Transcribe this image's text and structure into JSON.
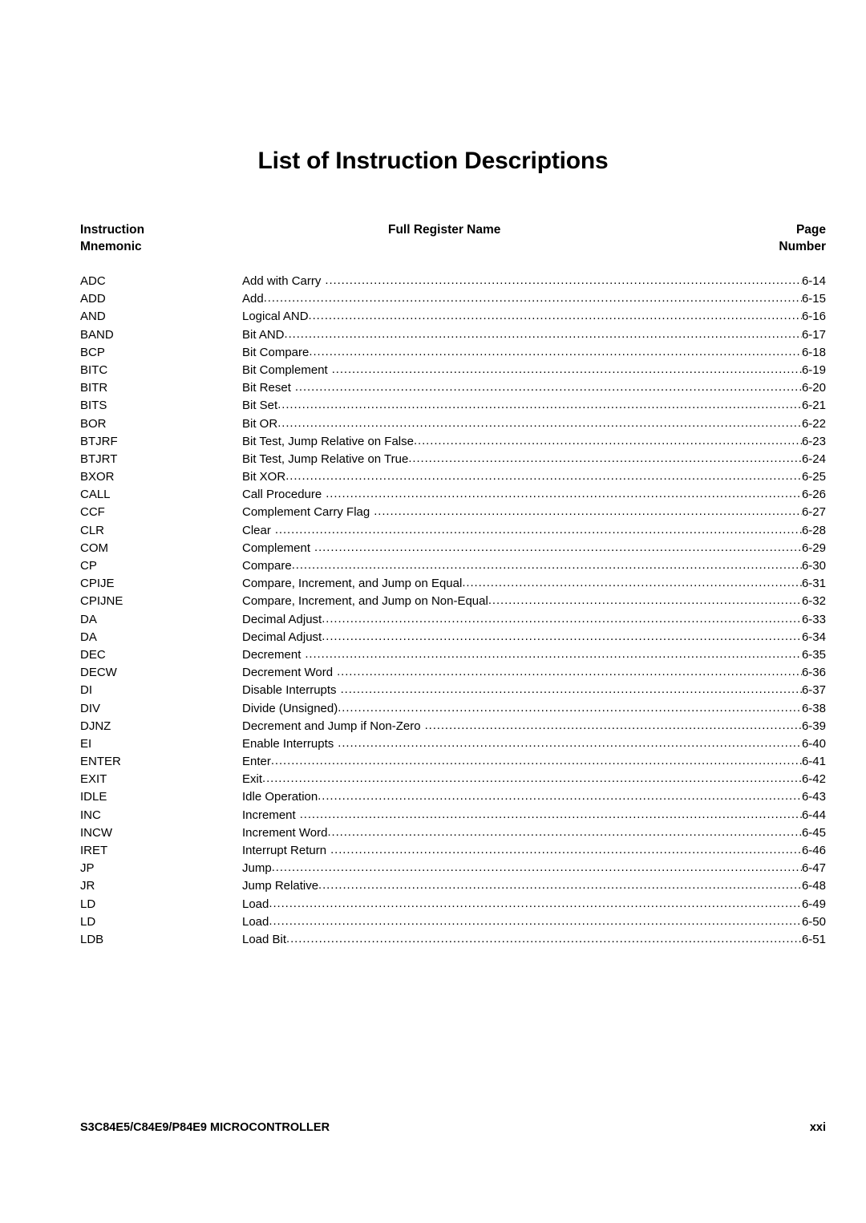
{
  "document": {
    "title": "List of Instruction Descriptions"
  },
  "table": {
    "headers": {
      "mnemonic": "Instruction\nMnemonic",
      "full_name": "Full Register Name",
      "page": "Page\nNumber"
    },
    "rows": [
      {
        "mnemonic": "ADC",
        "description": "Add with Carry",
        "page": "6-14",
        "leader_gap": true
      },
      {
        "mnemonic": "ADD",
        "description": "Add",
        "page": "6-15",
        "leader_gap": false
      },
      {
        "mnemonic": "AND",
        "description": "Logical AND",
        "page": "6-16",
        "leader_gap": false
      },
      {
        "mnemonic": "BAND",
        "description": "Bit AND",
        "page": "6-17",
        "leader_gap": false
      },
      {
        "mnemonic": "BCP",
        "description": "Bit Compare",
        "page": "6-18",
        "leader_gap": false
      },
      {
        "mnemonic": "BITC",
        "description": "Bit Complement",
        "page": "6-19",
        "leader_gap": true
      },
      {
        "mnemonic": "BITR",
        "description": "Bit Reset",
        "page": "6-20",
        "leader_gap": true
      },
      {
        "mnemonic": "BITS",
        "description": "Bit Set",
        "page": "6-21",
        "leader_gap": false
      },
      {
        "mnemonic": "BOR",
        "description": "Bit OR",
        "page": "6-22",
        "leader_gap": false
      },
      {
        "mnemonic": "BTJRF",
        "description": "Bit Test, Jump Relative on False",
        "page": "6-23",
        "leader_gap": false
      },
      {
        "mnemonic": "BTJRT",
        "description": "Bit Test, Jump Relative on True",
        "page": "6-24",
        "leader_gap": false
      },
      {
        "mnemonic": "BXOR",
        "description": "Bit XOR",
        "page": "6-25",
        "leader_gap": false
      },
      {
        "mnemonic": "CALL",
        "description": "Call Procedure",
        "page": "6-26",
        "leader_gap": true
      },
      {
        "mnemonic": "CCF",
        "description": "Complement Carry Flag",
        "page": "6-27",
        "leader_gap": true
      },
      {
        "mnemonic": "CLR",
        "description": "Clear",
        "page": "6-28",
        "leader_gap": true
      },
      {
        "mnemonic": "COM",
        "description": "Complement",
        "page": "6-29",
        "leader_gap": true
      },
      {
        "mnemonic": "CP",
        "description": "Compare",
        "page": "6-30",
        "leader_gap": false
      },
      {
        "mnemonic": "CPIJE",
        "description": "Compare, Increment, and Jump on Equal",
        "page": "6-31",
        "leader_gap": false
      },
      {
        "mnemonic": "CPIJNE",
        "description": "Compare, Increment, and Jump on Non-Equal",
        "page": "6-32",
        "leader_gap": false
      },
      {
        "mnemonic": "DA",
        "description": "Decimal Adjust",
        "page": "6-33",
        "leader_gap": false
      },
      {
        "mnemonic": "DA",
        "description": "Decimal Adjust",
        "page": "6-34",
        "leader_gap": false
      },
      {
        "mnemonic": "DEC",
        "description": "Decrement",
        "page": "6-35",
        "leader_gap": true
      },
      {
        "mnemonic": "DECW",
        "description": "Decrement Word",
        "page": "6-36",
        "leader_gap": true
      },
      {
        "mnemonic": "DI",
        "description": "Disable Interrupts",
        "page": "6-37",
        "leader_gap": true
      },
      {
        "mnemonic": "DIV",
        "description": "Divide (Unsigned)",
        "page": "6-38",
        "leader_gap": false
      },
      {
        "mnemonic": "DJNZ",
        "description": "Decrement and Jump if Non-Zero",
        "page": "6-39",
        "leader_gap": true
      },
      {
        "mnemonic": "EI",
        "description": "Enable Interrupts",
        "page": "6-40",
        "leader_gap": true
      },
      {
        "mnemonic": "ENTER",
        "description": "Enter",
        "page": "6-41",
        "leader_gap": false
      },
      {
        "mnemonic": "EXIT",
        "description": "Exit",
        "page": "6-42",
        "leader_gap": false
      },
      {
        "mnemonic": "IDLE",
        "description": "Idle Operation",
        "page": "6-43",
        "leader_gap": false
      },
      {
        "mnemonic": "INC",
        "description": "Increment",
        "page": "6-44",
        "leader_gap": true
      },
      {
        "mnemonic": "INCW",
        "description": "Increment Word",
        "page": "6-45",
        "leader_gap": false
      },
      {
        "mnemonic": "IRET",
        "description": "Interrupt Return",
        "page": "6-46",
        "leader_gap": true
      },
      {
        "mnemonic": "JP",
        "description": "Jump",
        "page": "6-47",
        "leader_gap": false
      },
      {
        "mnemonic": "JR",
        "description": "Jump Relative",
        "page": "6-48",
        "leader_gap": false
      },
      {
        "mnemonic": "LD",
        "description": "Load",
        "page": "6-49",
        "leader_gap": false
      },
      {
        "mnemonic": "LD",
        "description": "Load",
        "page": "6-50",
        "leader_gap": false
      },
      {
        "mnemonic": "LDB",
        "description": "Load Bit",
        "page": "6-51",
        "leader_gap": false
      }
    ]
  },
  "footer": {
    "product": "S3C84E5/C84E9/P84E9 MICROCONTROLLER",
    "page_number": "xxi"
  }
}
